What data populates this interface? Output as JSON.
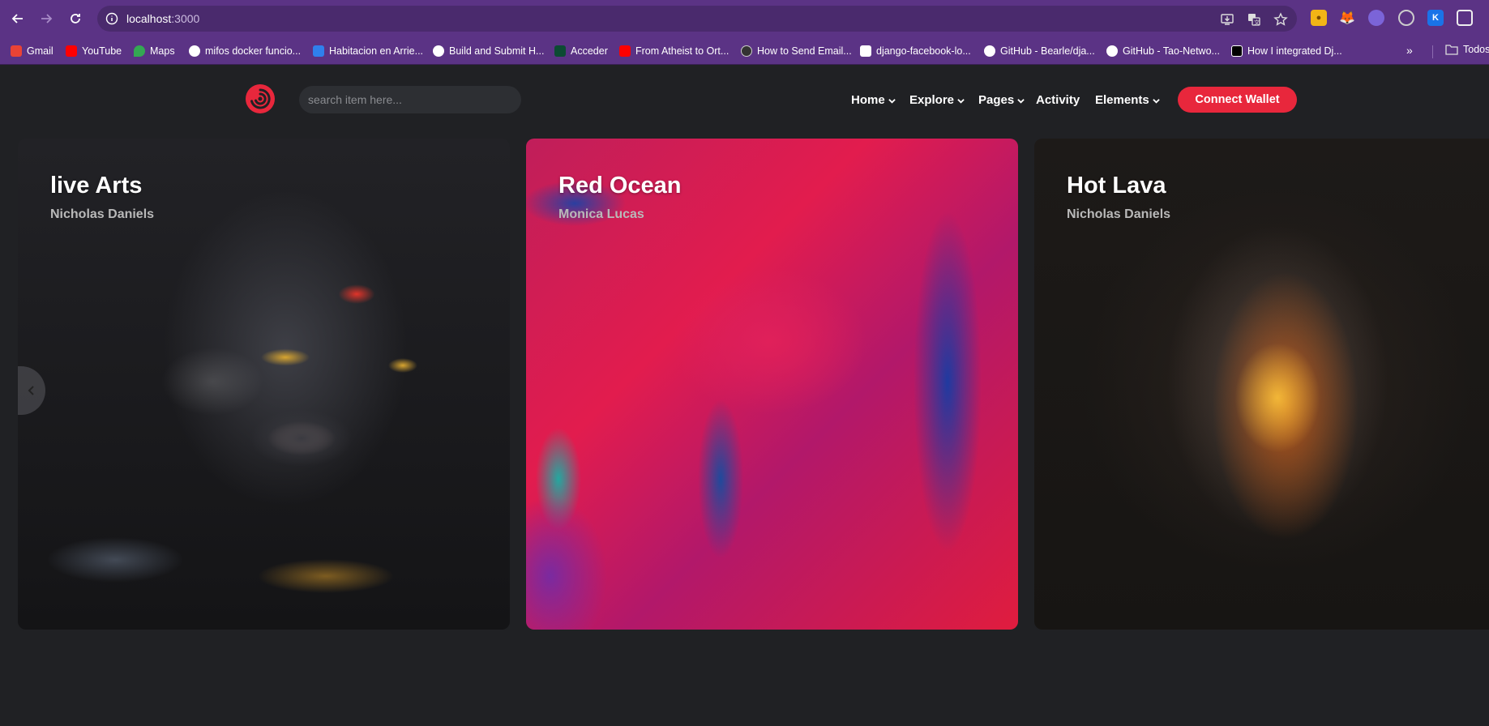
{
  "browser": {
    "url_host": "localhost",
    "url_port": ":3000",
    "bookmarks": [
      {
        "label": "Gmail",
        "color": "#ea4335"
      },
      {
        "label": "YouTube",
        "color": "#ff0000"
      },
      {
        "label": "Maps",
        "color": "#34a853"
      },
      {
        "label": "mifos docker funcio...",
        "color": "#ffffff"
      },
      {
        "label": "Habitacion en Arrie...",
        "color": "#2f80ed"
      },
      {
        "label": "Build and Submit H...",
        "color": "#ffffff"
      },
      {
        "label": "Acceder",
        "color": "#0c4b33"
      },
      {
        "label": "From Atheist to Ort...",
        "color": "#ff0000"
      },
      {
        "label": "How to Send Email...",
        "color": "#333333"
      },
      {
        "label": "django-facebook-lo...",
        "color": "#ffffff"
      },
      {
        "label": "GitHub - Bearle/dja...",
        "color": "#ffffff"
      },
      {
        "label": "GitHub - Tao-Netwo...",
        "color": "#ffffff"
      },
      {
        "label": "How I integrated Dj...",
        "color": "#000000"
      }
    ],
    "bookmarks_overflow": "»",
    "folder_label": "Todos"
  },
  "site": {
    "search_placeholder": "search item here...",
    "nav": [
      {
        "label": "Home",
        "dropdown": true
      },
      {
        "label": "Explore",
        "dropdown": true
      },
      {
        "label": "Pages",
        "dropdown": true
      },
      {
        "label": "Activity",
        "dropdown": false
      },
      {
        "label": "Elements",
        "dropdown": true
      }
    ],
    "connect_label": "Connect Wallet",
    "accent": "#e8273c"
  },
  "cards": [
    {
      "title": "live Arts",
      "author": "Nicholas Daniels"
    },
    {
      "title": "Red Ocean",
      "author": "Monica Lucas"
    },
    {
      "title": "Hot Lava",
      "author": "Nicholas Daniels"
    }
  ]
}
